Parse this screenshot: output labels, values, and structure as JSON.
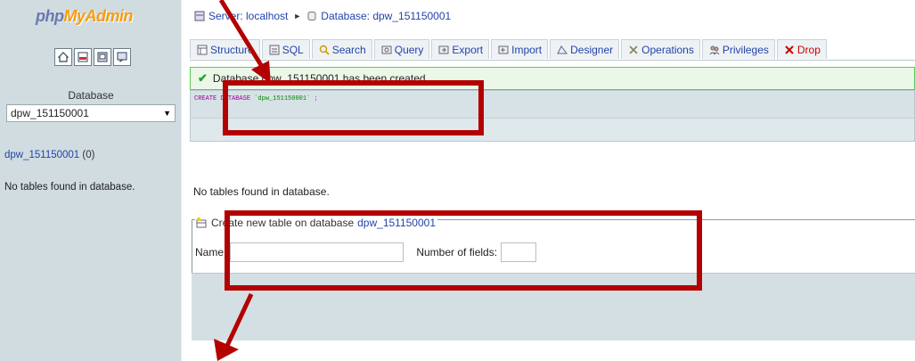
{
  "logo": {
    "php": "php",
    "myadmin": "MyAdmin"
  },
  "left": {
    "quick_icons": [
      "home-icon",
      "sql-query-icon",
      "query-window-icon",
      "docs-icon"
    ],
    "database_label": "Database",
    "database_selected": "dpw_151150001",
    "db_link": "dpw_151150001",
    "db_count": "(0)",
    "no_tables": "No tables found in database."
  },
  "breadcrumb": {
    "server": "Server: localhost",
    "database": "Database: dpw_151150001"
  },
  "tabs": [
    {
      "label": "Structure",
      "icon": "structure-icon"
    },
    {
      "label": "SQL",
      "icon": "sql-icon"
    },
    {
      "label": "Search",
      "icon": "search-icon"
    },
    {
      "label": "Query",
      "icon": "query-icon"
    },
    {
      "label": "Export",
      "icon": "export-icon"
    },
    {
      "label": "Import",
      "icon": "import-icon"
    },
    {
      "label": "Designer",
      "icon": "designer-icon"
    },
    {
      "label": "Operations",
      "icon": "operations-icon"
    },
    {
      "label": "Privileges",
      "icon": "privileges-icon"
    },
    {
      "label": "Drop",
      "icon": "drop-icon"
    }
  ],
  "message": {
    "success": "Database dpw_151150001 has been created.",
    "sql_kw1": "CREATE",
    "sql_kw2": "DATABASE",
    "sql_name": "`dpw_151150001`",
    "sql_end": ";"
  },
  "main": {
    "no_tables": "No tables found in database.",
    "create_label": "Create new table on database",
    "create_db": "dpw_151150001",
    "name_label": "Name:",
    "fields_label": "Number of fields:",
    "name_value": "",
    "fields_value": ""
  },
  "colors": {
    "annotation": "#b30000",
    "link": "#2244aa",
    "panel": "#d0dce0"
  }
}
